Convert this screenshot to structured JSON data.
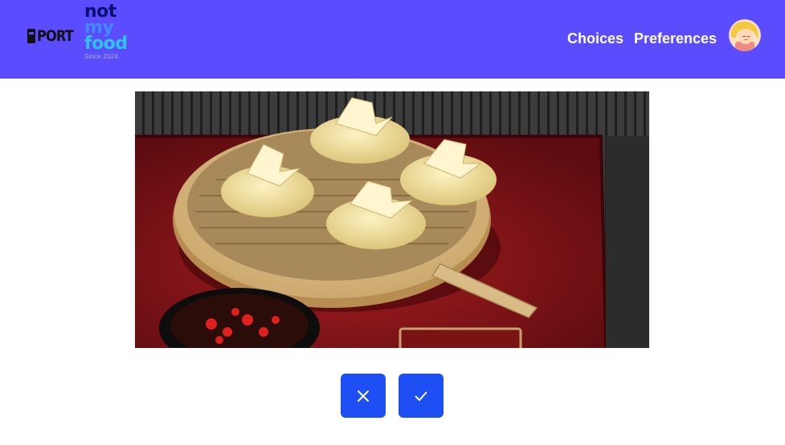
{
  "header": {
    "logo_text": "PORT",
    "brand": {
      "line1": "not",
      "line2": "my",
      "line3": "food",
      "since": "Since 2024"
    },
    "nav": [
      {
        "label": "Choices"
      },
      {
        "label": "Preferences"
      }
    ],
    "avatar_icon": "user-avatar"
  },
  "main": {
    "image_subject": "steamed dumplings in bamboo steamer with chili dipping sauce",
    "actions": {
      "reject_icon": "close-icon",
      "accept_icon": "check-icon"
    }
  },
  "colors": {
    "header_bg": "#5b4cff",
    "button_bg": "#1d4ff5",
    "nav_text": "#ffffff"
  }
}
